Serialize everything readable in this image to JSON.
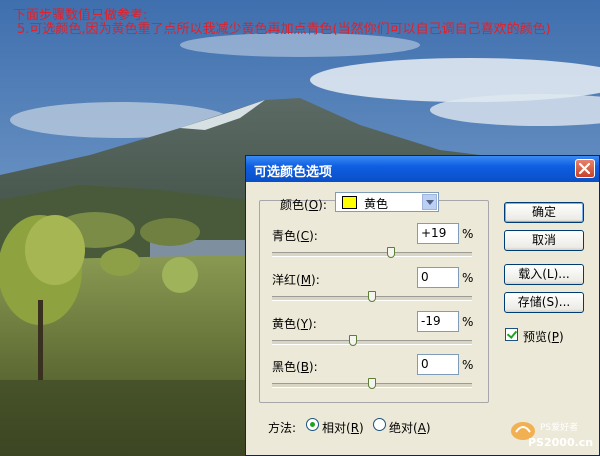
{
  "caption": {
    "line1": "下面步骤数值只做参考:",
    "line2": "5.可选颜色,因为黄色重了点所以我减少黄色再加点青色(当然你们可以自己调自己喜欢的颜色)"
  },
  "dialog": {
    "title": "可选颜色选项",
    "close_symbol": "✕",
    "colors_label": "颜色(",
    "colors_key": "O",
    "colors_suffix": "):",
    "selected_color": "黄色",
    "sliders": [
      {
        "label": "青色(",
        "key": "C",
        "suffix": "):",
        "value": "+19",
        "unit": "%",
        "position": 0.595
      },
      {
        "label": "洋红(",
        "key": "M",
        "suffix": "):",
        "value": "0",
        "unit": "%",
        "position": 0.5
      },
      {
        "label": "黄色(",
        "key": "Y",
        "suffix": "):",
        "value": "-19",
        "unit": "%",
        "position": 0.405
      },
      {
        "label": "黑色(",
        "key": "B",
        "suffix": "):",
        "value": "0",
        "unit": "%",
        "position": 0.5
      }
    ],
    "buttons": {
      "ok": "确定",
      "cancel": "取消",
      "load": "载入(L)...",
      "save": "存储(S)..."
    },
    "preview": {
      "label": "预览(",
      "key": "P",
      "suffix": ")",
      "checked": true
    },
    "method": {
      "label": "方法:",
      "relative": {
        "label": "相对(",
        "key": "R",
        "suffix": ")",
        "checked": true
      },
      "absolute": {
        "label": "绝对(",
        "key": "A",
        "suffix": ")",
        "checked": false
      }
    }
  },
  "watermark": {
    "line1": "PS爱好者",
    "line2": "PS2000.cn"
  },
  "colors": {
    "title_bar": "#0f5ee2",
    "caption_red": "#e0202a",
    "swatch": "#ffff00",
    "dialog_bg": "#ece9d8"
  }
}
